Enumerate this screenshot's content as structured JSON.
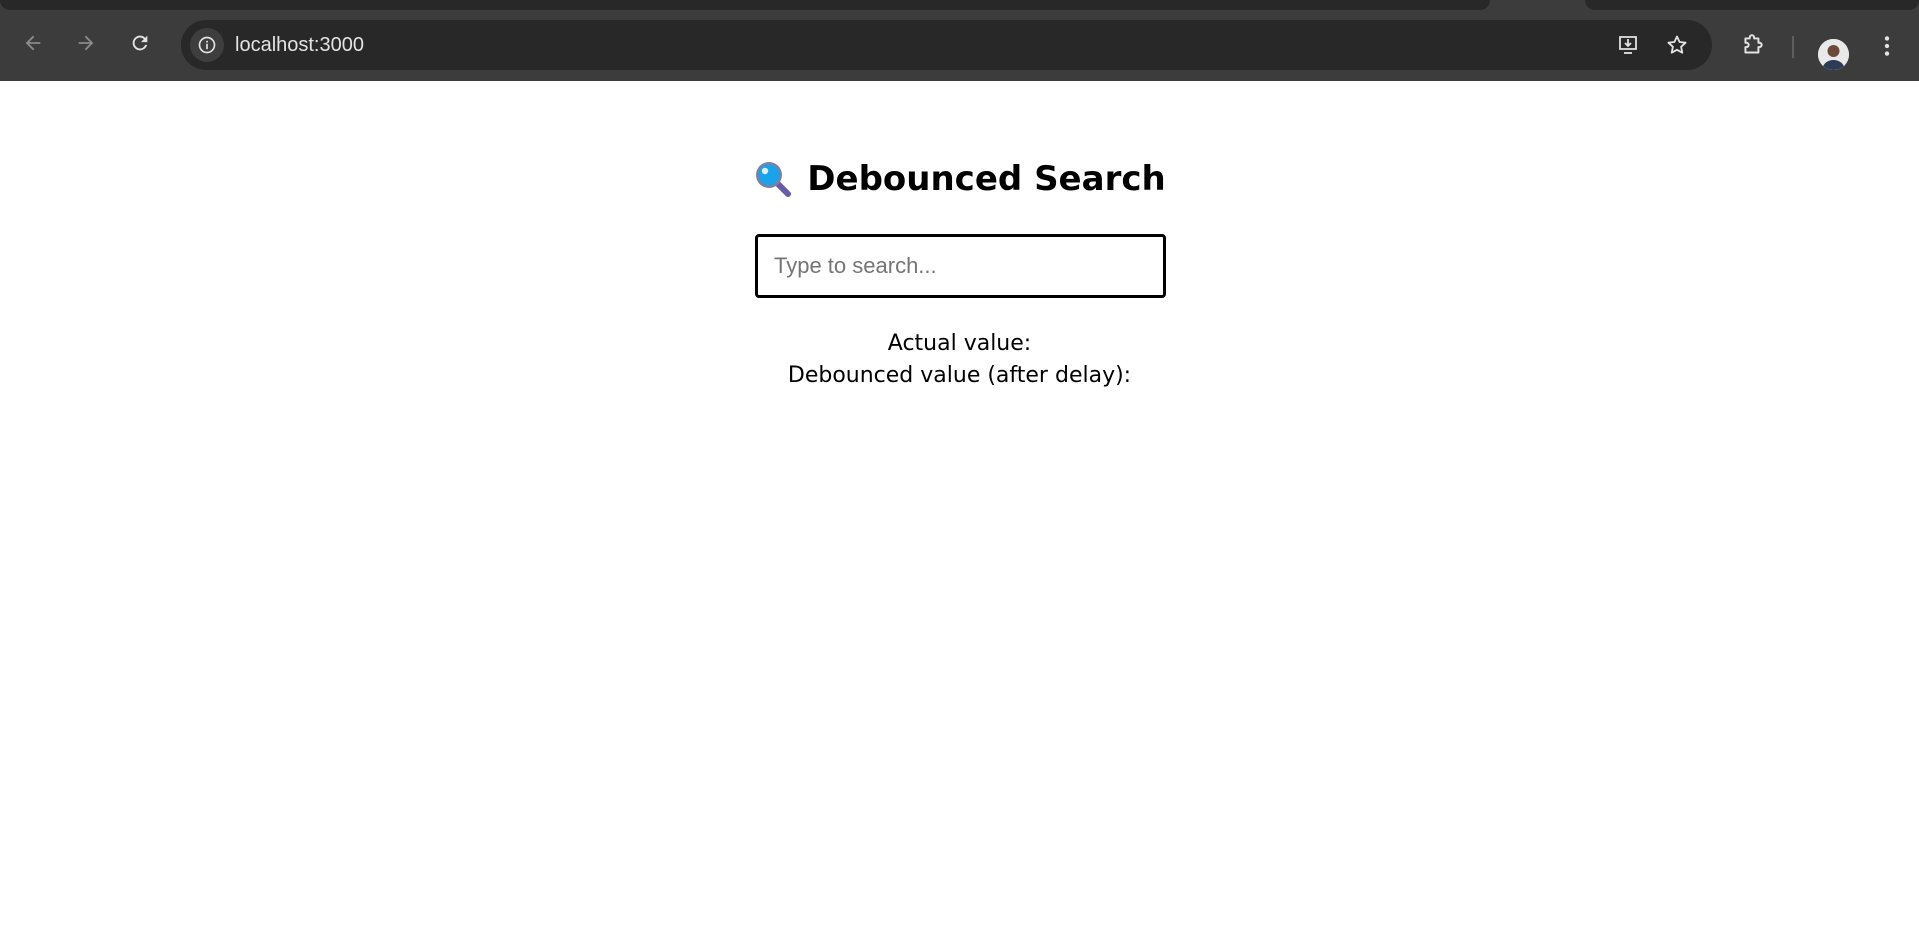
{
  "browser": {
    "url": "localhost:3000"
  },
  "app": {
    "heading": "Debounced Search",
    "search": {
      "placeholder": "Type to search...",
      "value": ""
    },
    "actual_label": "Actual value:",
    "debounced_label": "Debounced value (after delay):"
  },
  "icons": {
    "back": "arrow-left-icon",
    "forward": "arrow-right-icon",
    "reload": "reload-icon",
    "site_info": "info-icon",
    "install": "install-app-icon",
    "bookmark": "star-icon",
    "extensions": "puzzle-icon",
    "menu": "kebab-menu-icon",
    "heading_emoji": "magnifying-glass-icon"
  },
  "colors": {
    "chrome_bg": "#3c3c3c",
    "omnibox_bg": "#282828",
    "chrome_text": "#e3e3e3",
    "page_bg": "#ffffff",
    "input_border": "#000000"
  }
}
